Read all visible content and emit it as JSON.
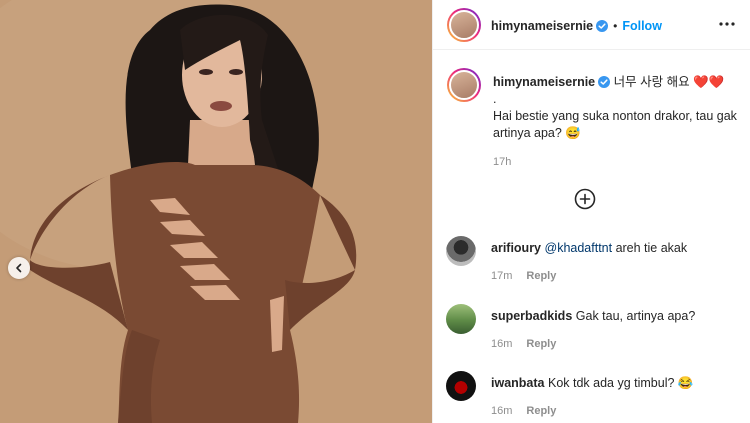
{
  "header": {
    "username": "himynameisernie",
    "separator": "•",
    "follow_label": "Follow"
  },
  "caption": {
    "username": "himynameisernie",
    "text_line1": "너무 사랑 해요 ❤️❤️",
    "text_line2": ".",
    "text_line3": "Hai bestie yang suka nonton drakor, tau gak artinya apa? 😅",
    "time": "17h"
  },
  "comments": [
    {
      "username": "arifioury",
      "mention": "@khadafttnt",
      "text": " areh tie akak",
      "time": "17m",
      "reply_label": "Reply"
    },
    {
      "username": "superbadkids",
      "mention": "",
      "text": "Gak tau, artinya apa?",
      "time": "16m",
      "reply_label": "Reply"
    },
    {
      "username": "iwanbata",
      "mention": "",
      "text": "Kok tdk ada yg timbul? 😂",
      "time": "16m",
      "reply_label": "Reply"
    }
  ],
  "icons": {
    "verified": "verified-badge-icon",
    "more": "more-options-icon",
    "load_more": "plus-circle-icon",
    "prev": "chevron-left-icon"
  },
  "colors": {
    "link": "#0095f6",
    "verified": "#3897f0",
    "muted": "#8e8e8e",
    "photo_bg": "#c39a74",
    "dress": "#7a4a33"
  }
}
